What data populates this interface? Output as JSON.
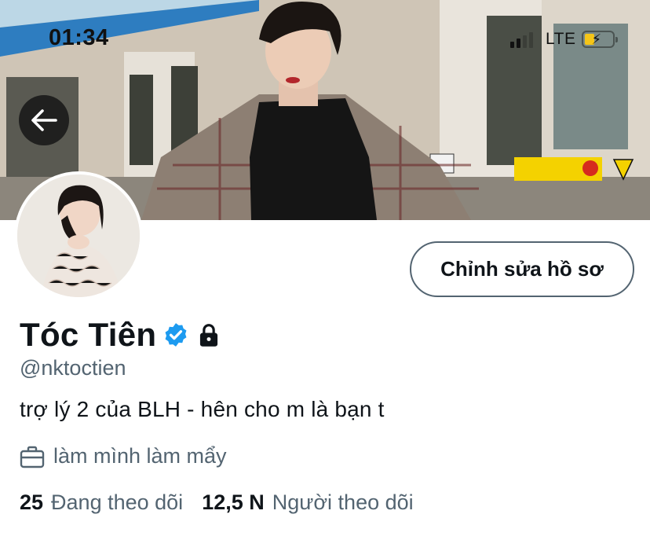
{
  "status_bar": {
    "time": "01:34",
    "network": "LTE",
    "battery_level": 0.35
  },
  "header": {
    "back_icon": "arrow-left-icon"
  },
  "profile": {
    "display_name": "Tóc Tiên",
    "handle": "@nktoctien",
    "bio": "trợ lý 2 của BLH - hên cho m là bạn t",
    "job_icon": "briefcase-icon",
    "job": "làm mình làm mẩy",
    "verified_icon": "verified-badge-icon",
    "protected_icon": "lock-icon",
    "edit_button_label": "Chỉnh sửa hồ sơ",
    "following_count": "25",
    "following_label": "Đang theo dõi",
    "followers_count": "12,5 N",
    "followers_label": "Người theo dõi"
  },
  "colors": {
    "verified": "#1d9bf0",
    "text_primary": "#0f1419",
    "text_secondary": "#536471"
  }
}
